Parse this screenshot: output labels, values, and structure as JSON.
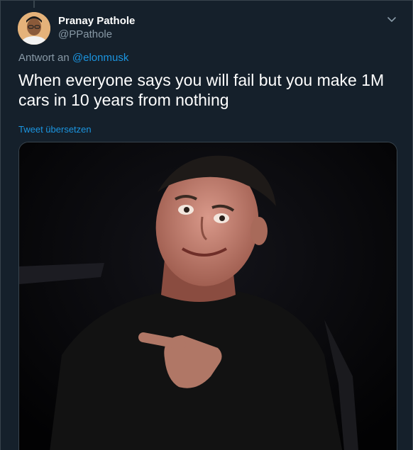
{
  "tweet": {
    "author": {
      "display_name": "Pranay Pathole",
      "handle": "@PPathole"
    },
    "reply_prefix": "Antwort an",
    "reply_to": "@elonmusk",
    "text": "When everyone says you will fail but you make 1M cars in 10 years from nothing",
    "translate_label": "Tweet übersetzen"
  },
  "icons": {
    "caret": "chevron-down-icon"
  },
  "colors": {
    "background": "#15202b",
    "accent": "#1b95e0",
    "secondary_text": "#8899a6",
    "border": "#38444d"
  }
}
